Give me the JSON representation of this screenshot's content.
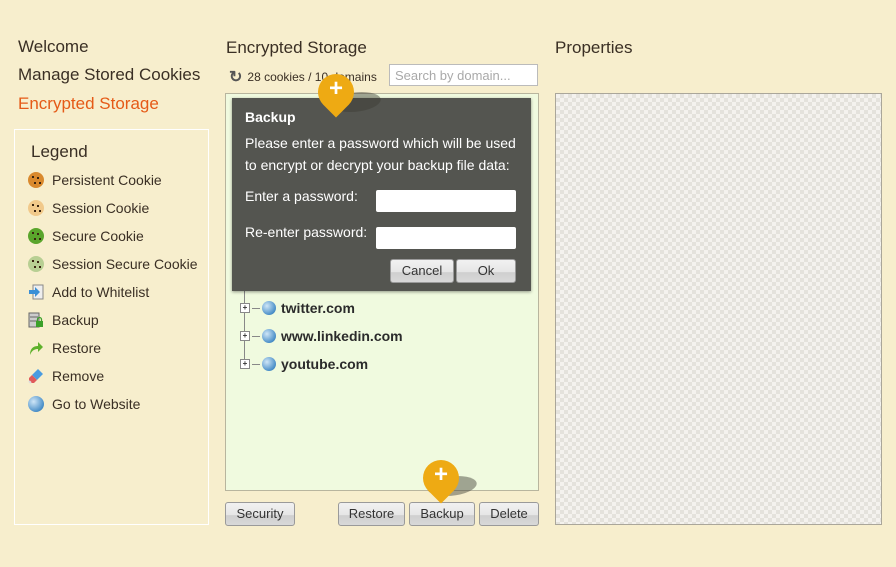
{
  "nav": {
    "items": [
      {
        "label": "Welcome",
        "active": false
      },
      {
        "label": "Manage Stored Cookies",
        "active": false
      },
      {
        "label": "Encrypted Storage",
        "active": true
      }
    ]
  },
  "legend": {
    "title": "Legend",
    "items": [
      {
        "icon": "persistent-cookie-icon",
        "label": "Persistent Cookie"
      },
      {
        "icon": "session-cookie-icon",
        "label": "Session Cookie"
      },
      {
        "icon": "secure-cookie-icon",
        "label": "Secure Cookie"
      },
      {
        "icon": "session-secure-cookie-icon",
        "label": "Session Secure Cookie"
      },
      {
        "icon": "add-whitelist-icon",
        "label": "Add to Whitelist"
      },
      {
        "icon": "backup-icon",
        "label": "Backup"
      },
      {
        "icon": "restore-icon",
        "label": "Restore"
      },
      {
        "icon": "remove-icon",
        "label": "Remove"
      },
      {
        "icon": "globe-icon",
        "label": "Go to Website"
      }
    ]
  },
  "storage": {
    "title": "Encrypted Storage",
    "count_text": "28 cookies / 10 domains",
    "search_placeholder": "Search by domain...",
    "domains": [
      "twitter.com",
      "www.linkedin.com",
      "youtube.com"
    ],
    "buttons": {
      "security": "Security",
      "restore": "Restore",
      "backup": "Backup",
      "delete": "Delete"
    }
  },
  "dialog": {
    "title": "Backup",
    "message": "Please enter a password which will be used to encrypt or decrypt your backup file data:",
    "password_label": "Enter a password:",
    "reenter_label": "Re-enter password:",
    "password_value": "",
    "reenter_value": "",
    "cancel_label": "Cancel",
    "ok_label": "Ok"
  },
  "properties": {
    "title": "Properties"
  },
  "hints": {
    "plus_symbol": "+"
  }
}
